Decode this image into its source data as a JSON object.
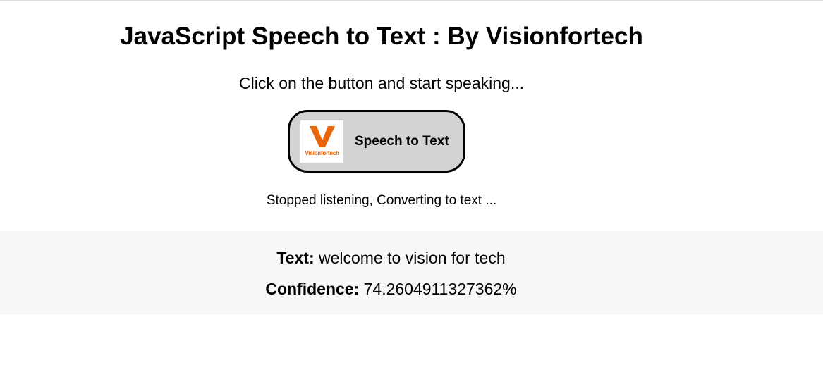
{
  "page": {
    "title": "JavaScript Speech to Text : By Visionfortech",
    "instruction": "Click on the button and start speaking..."
  },
  "button": {
    "label": "Speech to Text",
    "logo_letter": "V",
    "logo_text": "Visionfortech",
    "logo_icon": "visionfortech-logo-icon"
  },
  "status": {
    "text": "Stopped listening, Converting to text ..."
  },
  "result": {
    "text_label": "Text:",
    "text_value": "welcome to vision for tech",
    "confidence_label": "Confidence:",
    "confidence_value": "74.2604911327362%"
  },
  "colors": {
    "button_bg": "#d3d3d3",
    "panel_bg": "#f8f8f8",
    "logo_orange": "#e8650a"
  }
}
